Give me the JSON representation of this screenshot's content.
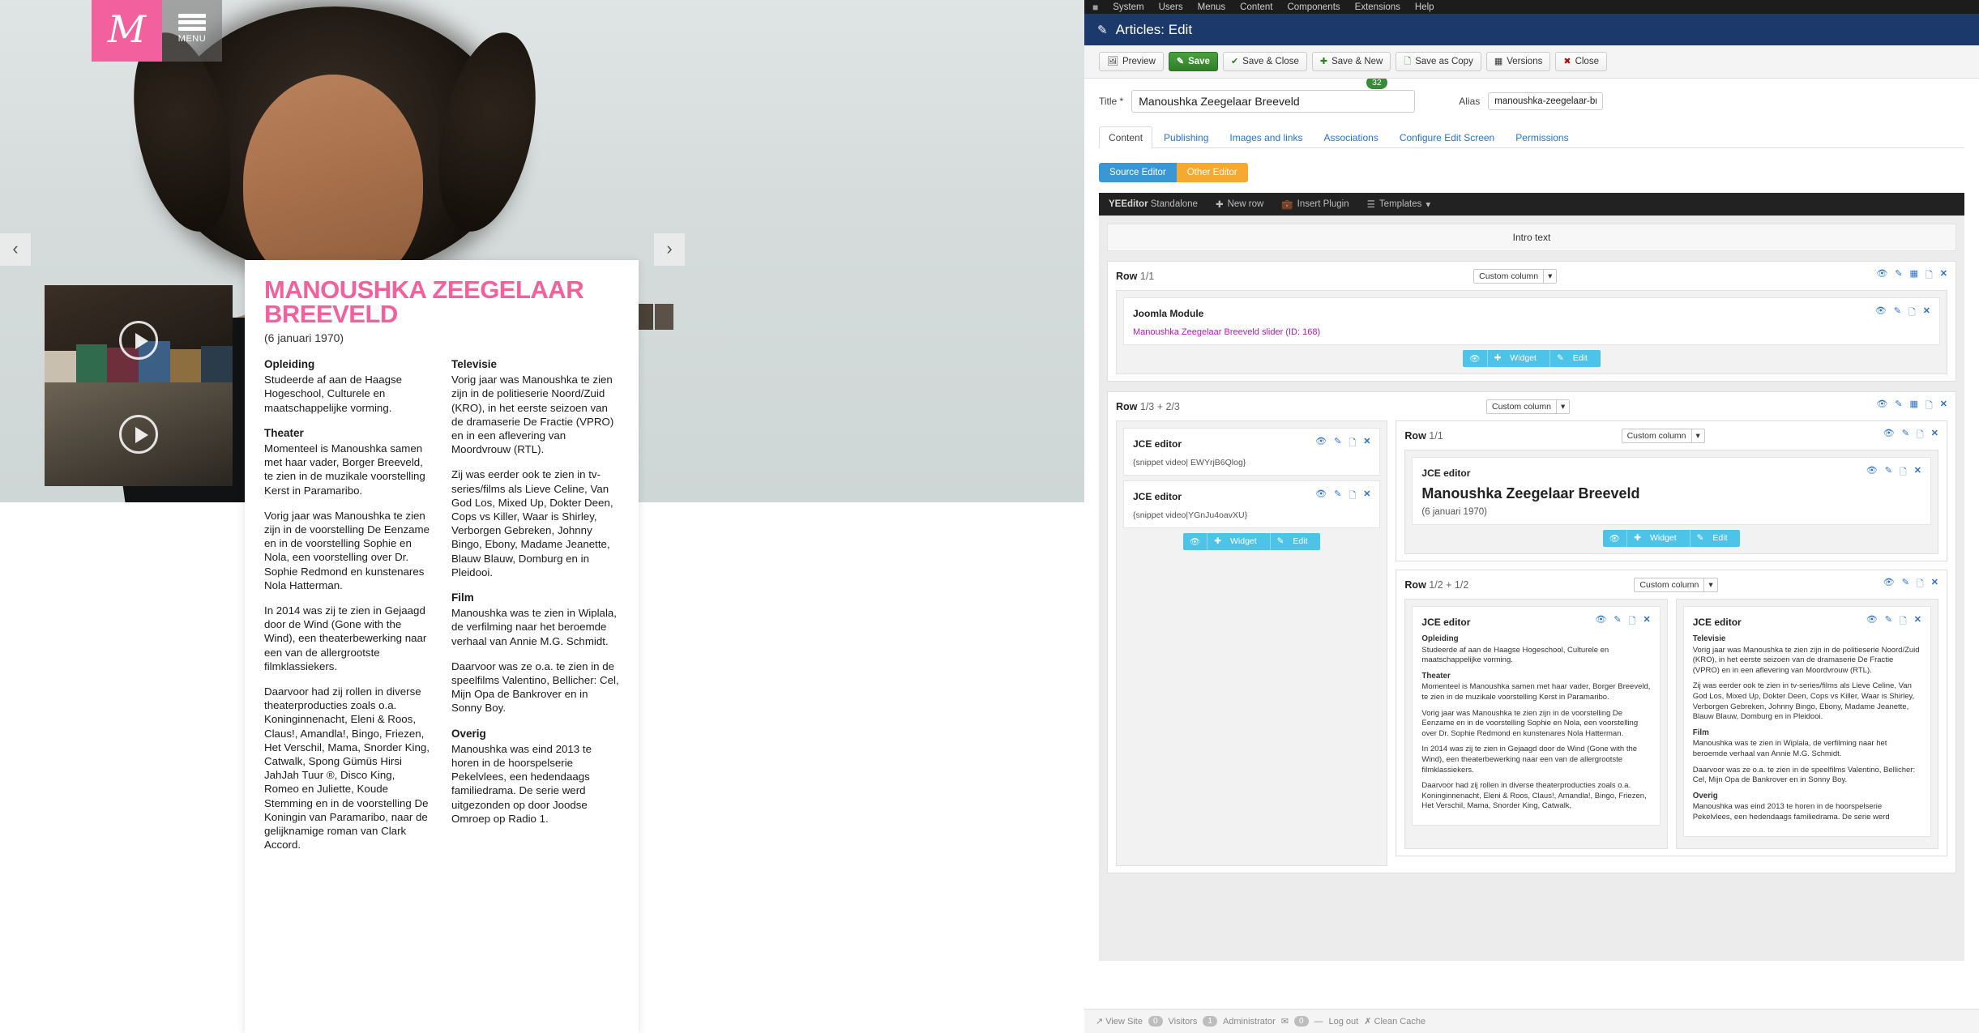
{
  "site": {
    "logo_letter": "M",
    "menu_label": "MENU",
    "prev_arrow": "‹",
    "next_arrow": "›",
    "title": "MANOUSHKA ZEEGELAAR BREEVELD",
    "date": "(6 januari 1970)",
    "left_column": [
      {
        "heading": "Opleiding",
        "paragraphs": [
          "Studeerde af aan de Haagse Hogeschool, Culturele en maatschappelijke vorming."
        ]
      },
      {
        "heading": "Theater",
        "paragraphs": [
          "Momenteel is Manoushka samen met haar vader, Borger Breeveld, te zien in de muzikale voorstelling Kerst in Paramaribo.",
          "Vorig jaar was Manoushka te zien zijn in de voorstelling De Eenzame en in de voorstelling Sophie en Nola, een voorstelling over Dr. Sophie Redmond en kunstenares Nola Hatterman.",
          "In 2014 was zij te zien in Gejaagd door de Wind (Gone with the Wind), een theaterbewerking naar een van de allergrootste filmklassiekers.",
          "Daarvoor had zij rollen in diverse theaterproducties zoals o.a. Koninginnenacht, Eleni & Roos, Claus!, Amandla!, Bingo, Friezen, Het Verschil, Mama, Snorder King, Catwalk, Spong Gümüs Hirsi JahJah Tuur ®, Disco King, Romeo en Juliette, Koude Stemming en in de voorstelling De Koningin van Paramaribo, naar de gelijknamige roman van Clark Accord."
        ]
      }
    ],
    "right_column": [
      {
        "heading": "Televisie",
        "paragraphs": [
          "Vorig jaar was Manoushka te zien zijn in de politieserie Noord/Zuid (KRO), in het eerste seizoen van de dramaserie De Fractie (VPRO) en in een aflevering van Moordvrouw (RTL).",
          "Zij was eerder ook te zien in tv-series/films als Lieve Celine, Van God Los, Mixed Up, Dokter Deen, Cops vs Killer, Waar is Shirley, Verborgen Gebreken, Johnny Bingo, Ebony, Madame Jeanette, Blauw Blauw, Domburg en in Pleidooi."
        ]
      },
      {
        "heading": "Film",
        "paragraphs": [
          "Manoushka was te zien in Wiplala, de verfilming naar het beroemde verhaal van Annie M.G. Schmidt.",
          "Daarvoor was ze o.a. te zien in de speelfilms Valentino, Bellicher: Cel, Mijn Opa de Bankrover en in Sonny Boy."
        ]
      },
      {
        "heading": "Overig",
        "paragraphs": [
          "Manoushka was eind 2013 te horen in de hoorspelserie Pekelvlees, een hedendaags familiedrama. De serie werd uitgezonden op door Joodse Omroep op Radio 1."
        ]
      }
    ]
  },
  "admin": {
    "topmenu": [
      "System",
      "Users",
      "Menus",
      "Content",
      "Components",
      "Extensions",
      "Help"
    ],
    "page_title": "Articles: Edit",
    "toolbar": [
      {
        "label": "Preview",
        "icon": "image-icon",
        "style": "default"
      },
      {
        "label": "Save",
        "icon": "pencil-square-icon",
        "style": "green"
      },
      {
        "label": "Save & Close",
        "icon": "check-icon",
        "style": "default"
      },
      {
        "label": "Save & New",
        "icon": "plus-icon",
        "style": "default"
      },
      {
        "label": "Save as Copy",
        "icon": "copy-icon",
        "style": "default"
      },
      {
        "label": "Versions",
        "icon": "archive-icon",
        "style": "default"
      },
      {
        "label": "Close",
        "icon": "cancel-icon",
        "style": "default"
      }
    ],
    "title_label": "Title *",
    "title_value": "Manoushka Zeegelaar Breeveld",
    "title_counter": "32",
    "alias_label": "Alias",
    "alias_value": "manoushka-zeegelaar-breeveld",
    "tabs": [
      "Content",
      "Publishing",
      "Images and links",
      "Associations",
      "Configure Edit Screen",
      "Permissions"
    ],
    "active_tab": "Content",
    "editor_buttons": {
      "source": "Source Editor",
      "other": "Other Editor"
    },
    "yeeditor": {
      "brand": "YEEditor",
      "brand_sub": "Standalone",
      "new_row": "New row",
      "insert_plugin": "Insert Plugin",
      "templates": "Templates"
    },
    "intro_band": "Intro text",
    "select_label": "Custom column",
    "widget_tools": {
      "preview": "👁",
      "widget": "Widget",
      "edit": "Edit"
    },
    "rows": [
      {
        "name": "Row",
        "ratio": "1/1",
        "widgets": [
          {
            "title": "Joomla Module",
            "link": "Manoushka Zeegelaar Breeveld slider (ID: 168)"
          }
        ]
      },
      {
        "name": "Row",
        "ratio": "1/3 + 2/3",
        "left_widgets": [
          {
            "title": "JCE editor",
            "snippet": "{snippet video| EWYrjB6Qlog}"
          },
          {
            "title": "JCE editor",
            "snippet": "{snippet video|YGnJu4oavXU}"
          }
        ],
        "inner_row": {
          "name": "Row",
          "ratio": "1/1",
          "widget": {
            "title": "JCE editor",
            "article_title": "Manoushka Zeegelaar Breeveld",
            "article_sub": "(6 januari 1970)"
          }
        },
        "inner_row2": {
          "name": "Row",
          "ratio": "1/2 + 1/2"
        }
      }
    ],
    "columns": [
      {
        "title": "JCE editor",
        "sections": [
          {
            "heading": "Opleiding",
            "paragraphs": [
              "Studeerde af aan de Haagse Hogeschool, Culturele en maatschappelijke vorming."
            ]
          },
          {
            "heading": "Theater",
            "paragraphs": [
              "Momenteel is Manoushka samen met haar vader, Borger Breeveld, te zien in de muzikale voorstelling Kerst in Paramaribo.",
              "Vorig jaar was Manoushka te zien zijn in de voorstelling De Eenzame en in de voorstelling Sophie en Nola, een voorstelling over Dr. Sophie Redmond en kunstenares Nola Hatterman.",
              "In 2014 was zij te zien in Gejaagd door de Wind (Gone with the Wind), een theaterbewerking naar een van de allergrootste filmklassiekers.",
              "Daarvoor had zij rollen in diverse theaterproducties zoals o.a. Koninginnenacht, Eleni & Roos, Claus!, Amandla!, Bingo, Friezen, Het Verschil, Mama, Snorder King, Catwalk,"
            ]
          }
        ]
      },
      {
        "title": "JCE editor",
        "sections": [
          {
            "heading": "Televisie",
            "paragraphs": [
              "Vorig jaar was Manoushka te zien zijn in de politieserie Noord/Zuid (KRO), in het eerste seizoen van de dramaserie De Fractie (VPRO) en in een aflevering van Moordvrouw (RTL).",
              "Zij was eerder ook te zien in tv-series/films als Lieve Celine, Van God Los, Mixed Up, Dokter Deen, Cops vs Killer, Waar is Shirley, Verborgen Gebreken, Johnny Bingo, Ebony, Madame Jeanette, Blauw Blauw, Domburg en in Pleidooi."
            ]
          },
          {
            "heading": "Film",
            "paragraphs": [
              "Manoushka was te zien in Wiplala, de verfilming naar het beroemde verhaal van Annie M.G. Schmidt.",
              "Daarvoor was ze o.a. te zien in de speelfilms Valentino, Bellicher: Cel, Mijn Opa de Bankrover en in Sonny Boy."
            ]
          },
          {
            "heading": "Overig",
            "paragraphs": [
              "Manoushka was eind 2013 te horen in de hoorspelserie Pekelvlees, een hedendaags familiedrama. De serie werd"
            ]
          }
        ]
      }
    ],
    "footer": {
      "view_site": "View Site",
      "visitors_count": "0",
      "visitors": "Visitors",
      "admin_count": "1",
      "administrator": "Administrator",
      "messages_count": "0",
      "log_out": "Log out",
      "clean_cache": "Clean Cache"
    }
  },
  "colors": {
    "brand_pink": "#f2609e",
    "admin_blue": "#1b3a6b",
    "save_green": "#2f7e27",
    "link_blue": "#2a73c9",
    "widget_cyan": "#4ec3e8",
    "source_editor_blue": "#3b97d3",
    "other_editor_orange": "#f5a930"
  }
}
